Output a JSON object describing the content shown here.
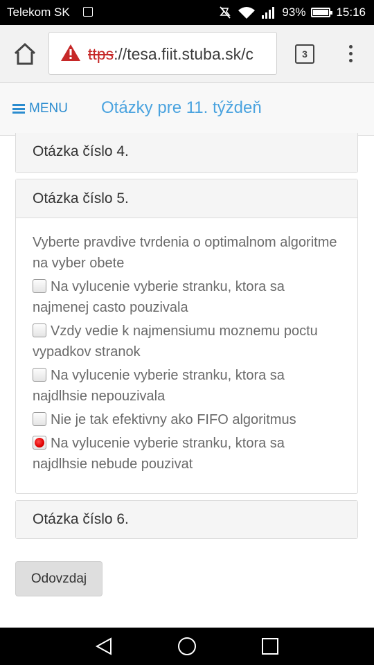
{
  "status_bar": {
    "carrier": "Telekom SK",
    "battery": "93%",
    "time": "15:16",
    "icons": [
      "image-icon",
      "mute-icon",
      "wifi-icon",
      "signal-icon",
      "battery-icon"
    ]
  },
  "browser": {
    "url_scheme": "ttps",
    "url_rest": "://tesa.fiit.stuba.sk/c",
    "tab_count": "3",
    "icons": [
      "home-icon",
      "warning-icon",
      "tabs-icon",
      "overflow-menu-icon"
    ]
  },
  "header": {
    "menu_label": "MENU",
    "title": "Otázky pre 11. týždeň"
  },
  "questions": [
    {
      "heading": "Otázka číslo 4."
    },
    {
      "heading": "Otázka číslo 5.",
      "text": "Vyberte pravdive tvrdenia o optimalnom algoritme na vyber obete",
      "options": [
        {
          "label": "Na vylucenie vyberie stranku, ktora sa najmenej casto pouzivala",
          "checked": false
        },
        {
          "label": "Vzdy vedie k najmensiumu moznemu poctu vypadkov stranok",
          "checked": false
        },
        {
          "label": "Na vylucenie vyberie stranku, ktora sa najdlhsie nepouzivala",
          "checked": false
        },
        {
          "label": "Nie je tak efektivny ako FIFO algoritmus",
          "checked": false
        },
        {
          "label": "Na vylucenie vyberie stranku, ktora sa najdlhsie nebude pouzivat",
          "checked": true
        }
      ]
    },
    {
      "heading": "Otázka číslo 6."
    }
  ],
  "submit_label": "Odovzdaj",
  "colors": {
    "accent": "#2b8ccf",
    "title": "#4aa3df",
    "warning": "#c62828",
    "checked": "#e00000"
  }
}
